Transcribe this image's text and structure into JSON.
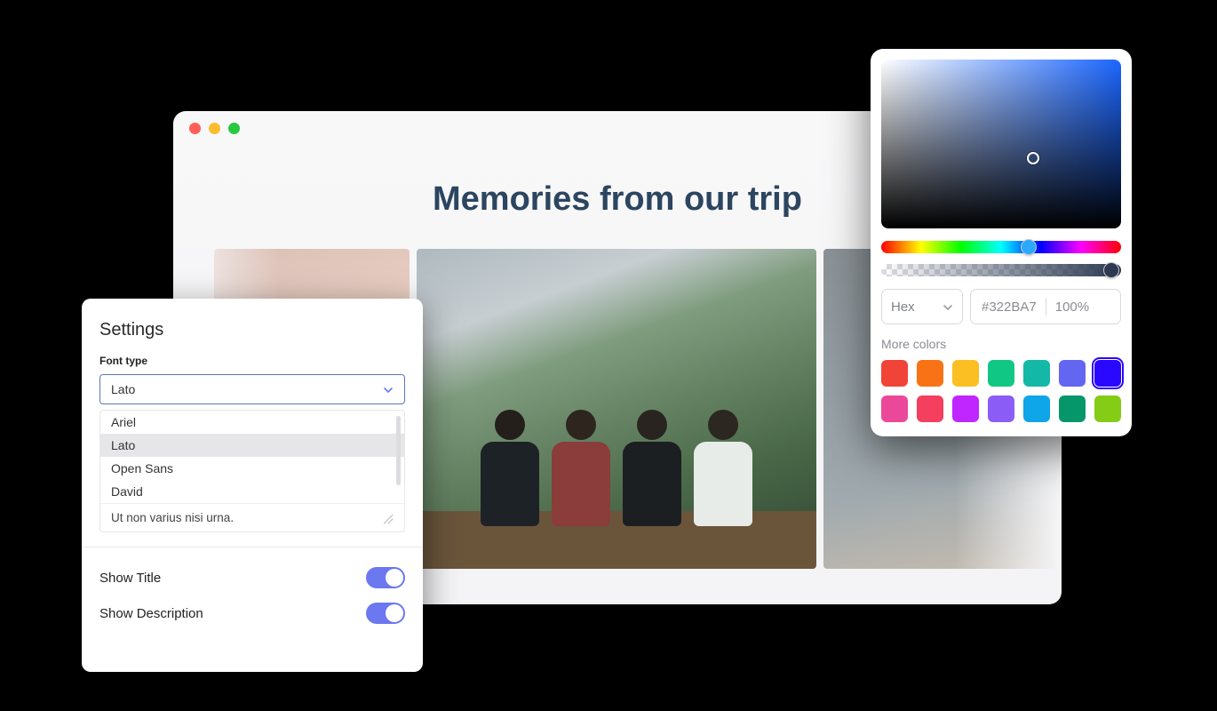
{
  "browser": {
    "traffic_lights": [
      "close",
      "minimize",
      "maximize"
    ],
    "page_title": "Memories from our trip"
  },
  "settings": {
    "title": "Settings",
    "font_type_label": "Font type",
    "selected_font": "Lato",
    "font_options": [
      "Ariel",
      "Lato",
      "Open Sans",
      "David"
    ],
    "selected_index": 1,
    "sample_text": "Ut non varius nisi urna.",
    "toggles": [
      {
        "label": "Show Title",
        "on": true
      },
      {
        "label": "Show Description",
        "on": true
      }
    ]
  },
  "picker": {
    "format_label": "Hex",
    "hex_value": "#322BA7",
    "alpha_value": "100%",
    "more_label": "More colors",
    "swatches_row1": [
      "#f04438",
      "#f97316",
      "#fbbf24",
      "#10c884",
      "#14b8a6",
      "#6366f1",
      "#2a07ff"
    ],
    "swatches_row2": [
      "#ec4899",
      "#f43f5e",
      "#c026ff",
      "#8b5cf6",
      "#0ea5e9",
      "#059669",
      "#84cc16"
    ],
    "selected_swatch_index": 6
  }
}
